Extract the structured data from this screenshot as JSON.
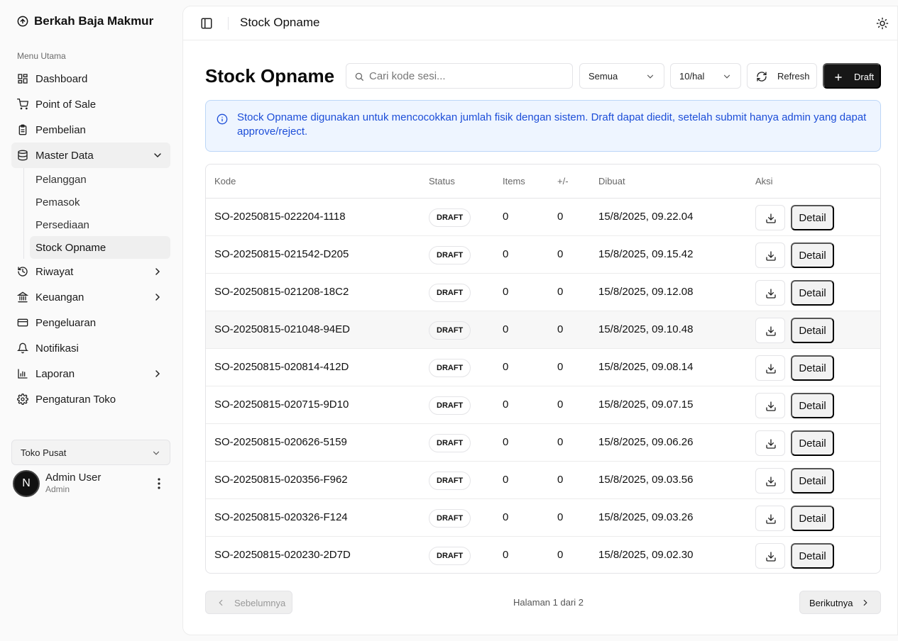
{
  "brand": {
    "name": "Berkah Baja Makmur",
    "icon": "circle-arrow-up-icon"
  },
  "sidebar": {
    "group_label": "Menu Utama",
    "items": [
      {
        "label": "Dashboard",
        "icon": "layout-dashboard-icon"
      },
      {
        "label": "Point of Sale",
        "icon": "shopping-cart-icon"
      },
      {
        "label": "Pembelian",
        "icon": "clipboard-icon"
      },
      {
        "label": "Master Data",
        "icon": "database-icon",
        "expanded": true
      },
      {
        "label": "Riwayat",
        "icon": "history-icon"
      },
      {
        "label": "Keuangan",
        "icon": "landmark-icon"
      },
      {
        "label": "Pengeluaran",
        "icon": "credit-card-icon"
      },
      {
        "label": "Notifikasi",
        "icon": "bell-icon"
      },
      {
        "label": "Laporan",
        "icon": "bar-chart-icon"
      },
      {
        "label": "Pengaturan Toko",
        "icon": "gear-icon"
      }
    ],
    "master_data_sub": [
      "Pelanggan",
      "Pemasok",
      "Persediaan",
      "Stock Opname"
    ],
    "active_sub": "Stock Opname",
    "store": "Toko Pusat",
    "user": {
      "initial": "N",
      "name": "Admin User",
      "role": "Admin"
    }
  },
  "topbar": {
    "title": "Stock Opname"
  },
  "page": {
    "title": "Stock Opname",
    "search_placeholder": "Cari kode sesi...",
    "status_filter": "Semua",
    "per_page": "10/hal",
    "refresh_label": "Refresh",
    "draft_label": "Draft",
    "info_text": "Stock Opname digunakan untuk mencocokkan jumlah fisik dengan sistem. Draft dapat diedit, setelah submit hanya admin yang dapat approve/reject."
  },
  "table": {
    "headers": {
      "kode": "Kode",
      "status": "Status",
      "items": "Items",
      "diff": "+/-",
      "dibuat": "Dibuat",
      "aksi": "Aksi"
    },
    "detail_label": "Detail",
    "rows": [
      {
        "kode": "SO-20250815-022204-1118",
        "status": "DRAFT",
        "items": "0",
        "diff": "0",
        "dibuat": "15/8/2025, 09.22.04"
      },
      {
        "kode": "SO-20250815-021542-D205",
        "status": "DRAFT",
        "items": "0",
        "diff": "0",
        "dibuat": "15/8/2025, 09.15.42"
      },
      {
        "kode": "SO-20250815-021208-18C2",
        "status": "DRAFT",
        "items": "0",
        "diff": "0",
        "dibuat": "15/8/2025, 09.12.08"
      },
      {
        "kode": "SO-20250815-021048-94ED",
        "status": "DRAFT",
        "items": "0",
        "diff": "0",
        "dibuat": "15/8/2025, 09.10.48"
      },
      {
        "kode": "SO-20250815-020814-412D",
        "status": "DRAFT",
        "items": "0",
        "diff": "0",
        "dibuat": "15/8/2025, 09.08.14"
      },
      {
        "kode": "SO-20250815-020715-9D10",
        "status": "DRAFT",
        "items": "0",
        "diff": "0",
        "dibuat": "15/8/2025, 09.07.15"
      },
      {
        "kode": "SO-20250815-020626-5159",
        "status": "DRAFT",
        "items": "0",
        "diff": "0",
        "dibuat": "15/8/2025, 09.06.26"
      },
      {
        "kode": "SO-20250815-020356-F962",
        "status": "DRAFT",
        "items": "0",
        "diff": "0",
        "dibuat": "15/8/2025, 09.03.56"
      },
      {
        "kode": "SO-20250815-020326-F124",
        "status": "DRAFT",
        "items": "0",
        "diff": "0",
        "dibuat": "15/8/2025, 09.03.26"
      },
      {
        "kode": "SO-20250815-020230-2D7D",
        "status": "DRAFT",
        "items": "0",
        "diff": "0",
        "dibuat": "15/8/2025, 09.02.30"
      }
    ]
  },
  "pagination": {
    "prev": "Sebelumnya",
    "info": "Halaman 1 dari 2",
    "next": "Berikutnya"
  },
  "colors": {
    "accent": "#171717",
    "info_bg": "#eef5ff",
    "info_text": "#1d4ed8"
  }
}
